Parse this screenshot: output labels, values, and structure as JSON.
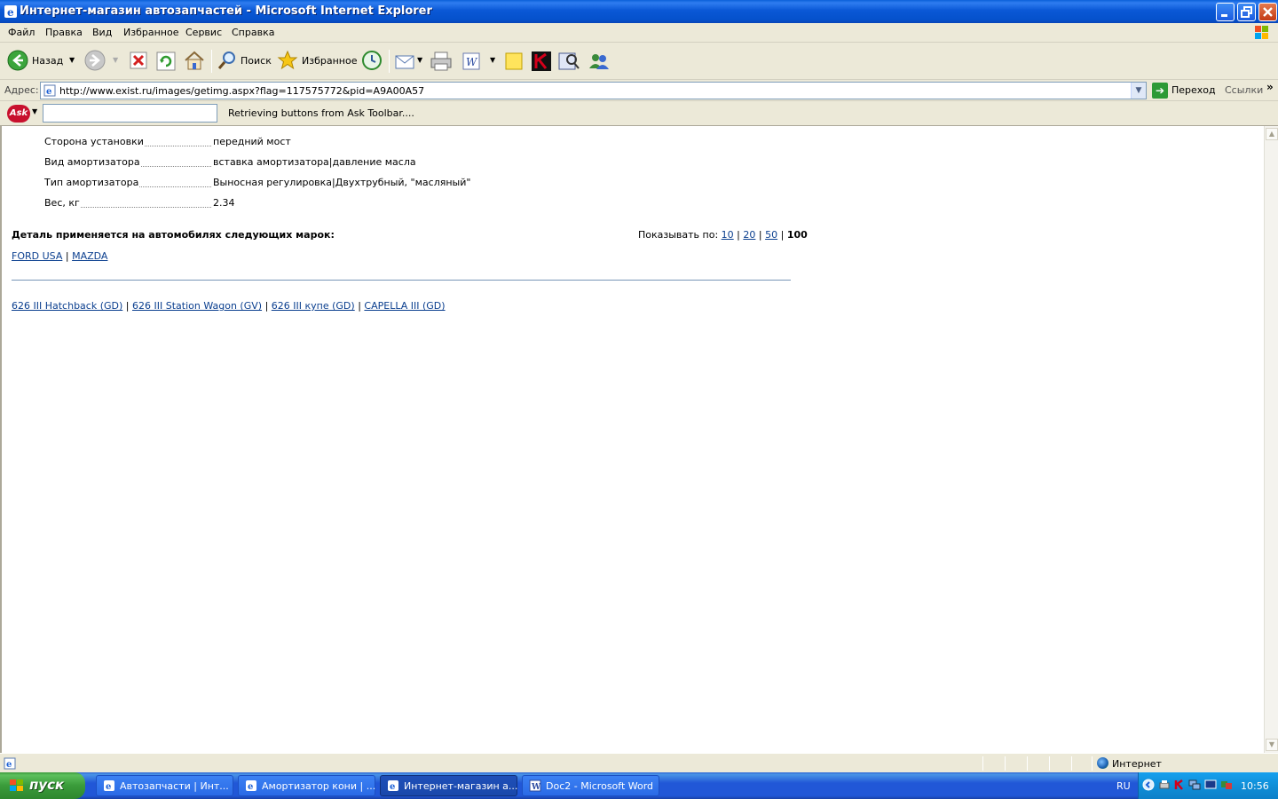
{
  "window": {
    "title": "Интернет-магазин автозапчастей - Microsoft Internet Explorer"
  },
  "menu": [
    "Файл",
    "Правка",
    "Вид",
    "Избранное",
    "Сервис",
    "Справка"
  ],
  "toolbar": {
    "back_label": "Назад",
    "search_label": "Поиск",
    "favorites_label": "Избранное"
  },
  "address": {
    "label": "Адрес:",
    "value": "http://www.exist.ru/images/getimg.aspx?flag=117575772&pid=A9A00A57",
    "go_label": "Переход",
    "links_label": "Ссылки"
  },
  "ask_toolbar": {
    "logo": "Ask",
    "search_value": "",
    "status": "Retrieving buttons from Ask Toolbar...."
  },
  "properties": [
    {
      "name": "Сторона установки",
      "value": "передний мост"
    },
    {
      "name": "Вид амортизатора",
      "value": "вставка амортизатора|давление масла"
    },
    {
      "name": "Тип амортизатора",
      "value": "Выносная регулировка|Двухтрубный, \"масляный\""
    },
    {
      "name": "Вес, кг",
      "value": "2.34"
    }
  ],
  "applies": {
    "title": "Деталь применяется на автомобилях следующих марок:",
    "show_by_label": "Показывать по:",
    "page_sizes": [
      "10",
      "20",
      "50"
    ],
    "current_page_size": "100",
    "brands": [
      "FORD USA",
      "MAZDA"
    ],
    "models": [
      "626 III Hatchback (GD)",
      "626 III Station Wagon (GV)",
      "626 III купе (GD)",
      "CAPELLA III (GD)"
    ]
  },
  "statusbar": {
    "text": "",
    "zone": "Интернет"
  },
  "taskbar": {
    "start_label": "пуск",
    "tasks": [
      {
        "label": "Автозапчасти | Инт..."
      },
      {
        "label": "Амортизатор кони | ..."
      },
      {
        "label": "Интернет-магазин а..."
      },
      {
        "label": "Doc2 - Microsoft Word"
      }
    ],
    "language": "RU",
    "clock": "10:56"
  },
  "colors": {
    "link": "#0b3f8f",
    "titlebar": "#0a58d6",
    "taskbar": "#2157d7",
    "start": "#3a9b3a"
  }
}
